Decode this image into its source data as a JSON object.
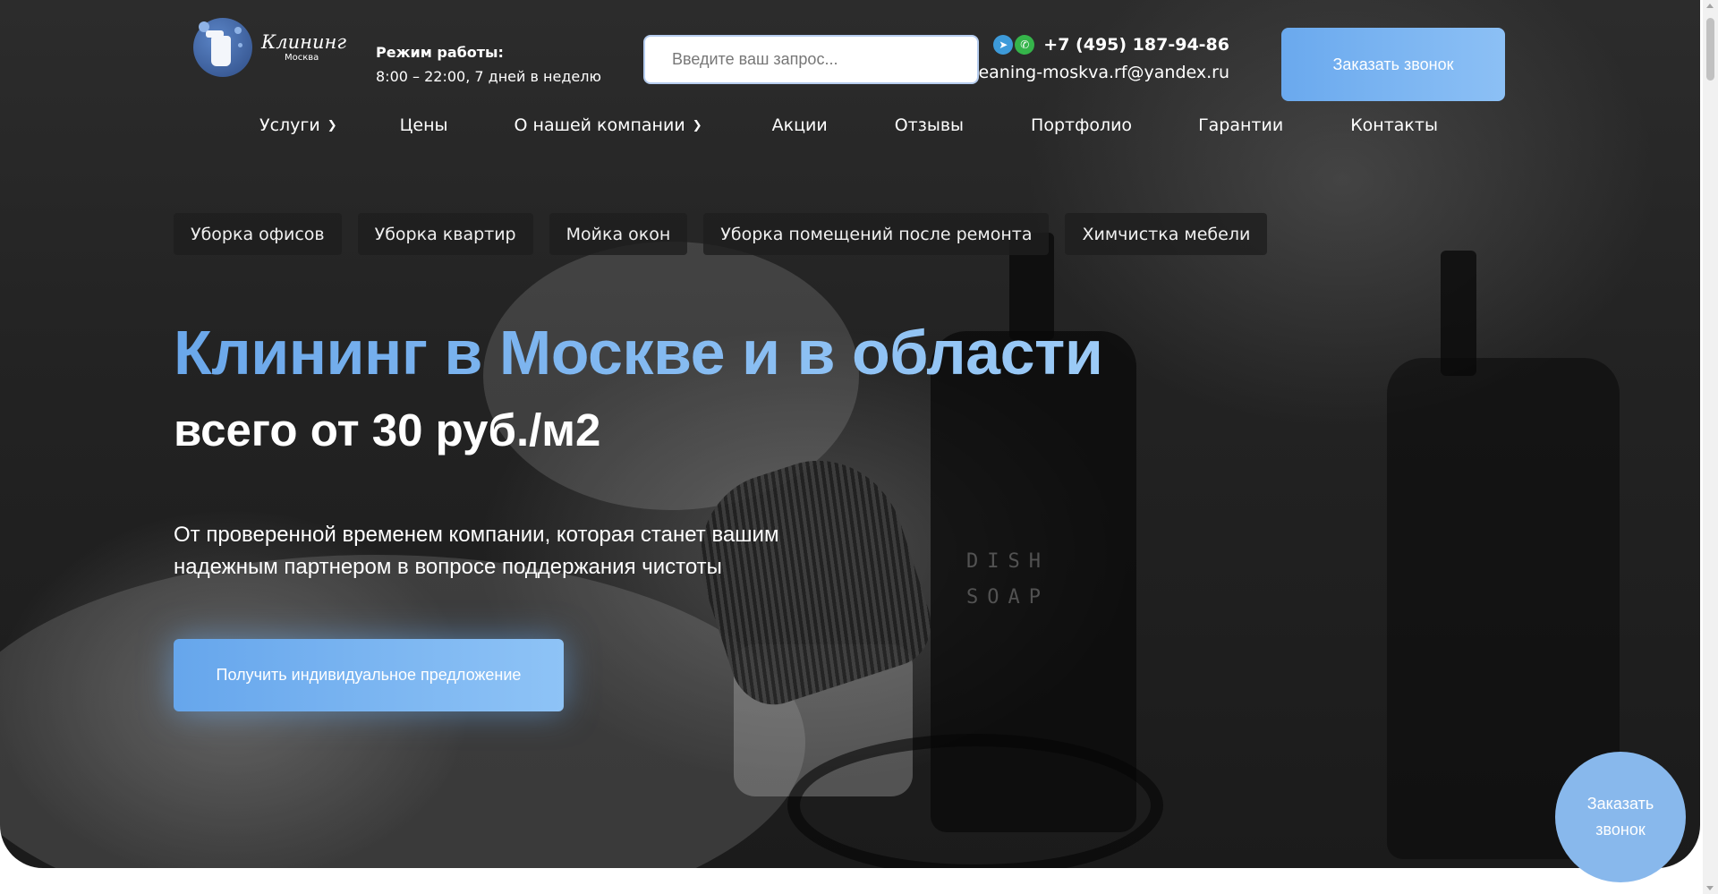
{
  "header": {
    "logo": {
      "title": "Клининг",
      "subtitle": "Москва"
    },
    "hours": {
      "label": "Режим работы:",
      "value": "8:00 – 22:00, 7 дней в неделю"
    },
    "search": {
      "placeholder": "Введите ваш запрос..."
    },
    "contacts": {
      "phone": "+7 (495) 187-94-86",
      "email": "cleaning-moskva.rf@yandex.ru",
      "messengers": [
        "telegram-icon",
        "whatsapp-icon"
      ]
    },
    "cta_label": "Заказать звонок"
  },
  "nav": [
    {
      "label": "Услуги",
      "has_dropdown": true
    },
    {
      "label": "Цены",
      "has_dropdown": false
    },
    {
      "label": "О нашей компании",
      "has_dropdown": true
    },
    {
      "label": "Акции",
      "has_dropdown": false
    },
    {
      "label": "Отзывы",
      "has_dropdown": false
    },
    {
      "label": "Портфолио",
      "has_dropdown": false
    },
    {
      "label": "Гарантии",
      "has_dropdown": false
    },
    {
      "label": "Контакты",
      "has_dropdown": false
    }
  ],
  "chips": [
    "Уборка офисов",
    "Уборка квартир",
    "Мойка окон",
    "Уборка помещений после ремонта",
    "Химчистка мебели"
  ],
  "hero": {
    "title": "Клининг в Москве и в области",
    "subtitle": "всего от 30 руб./м2",
    "lead_line1": "От проверенной временем компании, которая станет вашим",
    "lead_line2": "надежным партнером в вопросе поддержания чистоты",
    "cta_label": "Получить индивидуальное предложение"
  },
  "floating_cta": {
    "line1": "Заказать",
    "line2": "звонок"
  },
  "colors": {
    "accent": "#6aa9ee",
    "accent_light": "#8cc0f5",
    "hero_bg": "#232323",
    "text": "#ffffff"
  }
}
